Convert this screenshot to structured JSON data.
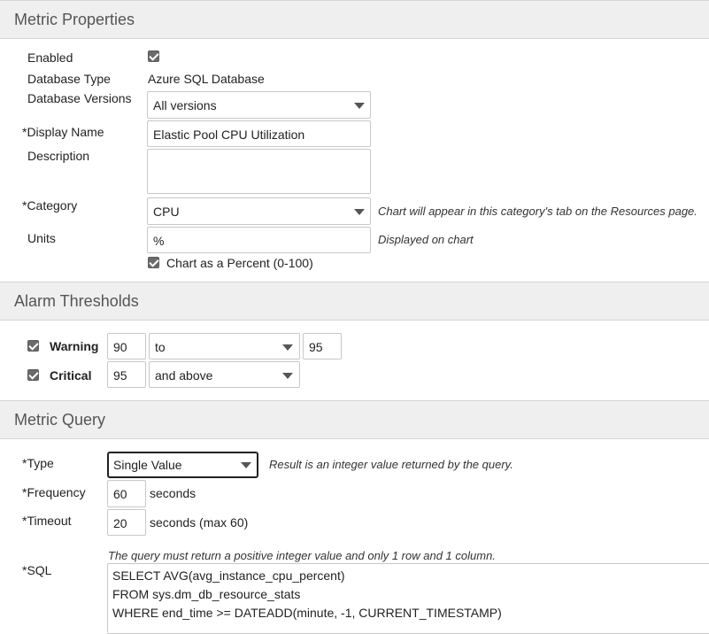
{
  "metric_properties": {
    "title": "Metric Properties",
    "enabled_label": "Enabled",
    "enabled": true,
    "database_type_label": "Database Type",
    "database_type_value": "Azure SQL Database",
    "database_versions_label": "Database Versions",
    "database_versions_value": "All versions",
    "display_name_label": "*Display Name",
    "display_name_value": "Elastic Pool CPU Utilization",
    "description_label": "Description",
    "description_value": "",
    "category_label": "*Category",
    "category_value": "CPU",
    "category_hint": "Chart will appear in this category's tab on the Resources page.",
    "units_label": "Units",
    "units_value": "%",
    "units_hint": "Displayed on chart",
    "chart_percent_label": "Chart as a Percent (0-100)",
    "chart_percent": true
  },
  "alarm_thresholds": {
    "title": "Alarm Thresholds",
    "warning": {
      "label": "Warning",
      "checked": true,
      "from_value": "90",
      "operator": "to",
      "to_value": "95"
    },
    "critical": {
      "label": "Critical",
      "checked": true,
      "from_value": "95",
      "operator": "and above"
    }
  },
  "metric_query": {
    "title": "Metric Query",
    "type_label": "*Type",
    "type_value": "Single Value",
    "type_hint": "Result is an integer value returned by the query.",
    "frequency_label": "*Frequency",
    "frequency_value": "60",
    "frequency_unit": "seconds",
    "timeout_label": "*Timeout",
    "timeout_value": "20",
    "timeout_unit": "seconds (max 60)",
    "sql_hint": "The query must return a positive integer value and only 1 row and 1 column.",
    "sql_label": "*SQL",
    "sql_lines": [
      "SELECT AVG(avg_instance_cpu_percent)",
      "FROM sys.dm_db_resource_stats",
      "WHERE end_time >= DATEADD(minute, -1, CURRENT_TIMESTAMP)"
    ]
  },
  "colors": {
    "section_header_bg": "#efefef",
    "checkbox_fill": "#6b6b6b",
    "focus_border": "#222222"
  },
  "icons": {
    "checkbox": "checkmark-icon",
    "dropdown": "chevron-down-icon"
  }
}
